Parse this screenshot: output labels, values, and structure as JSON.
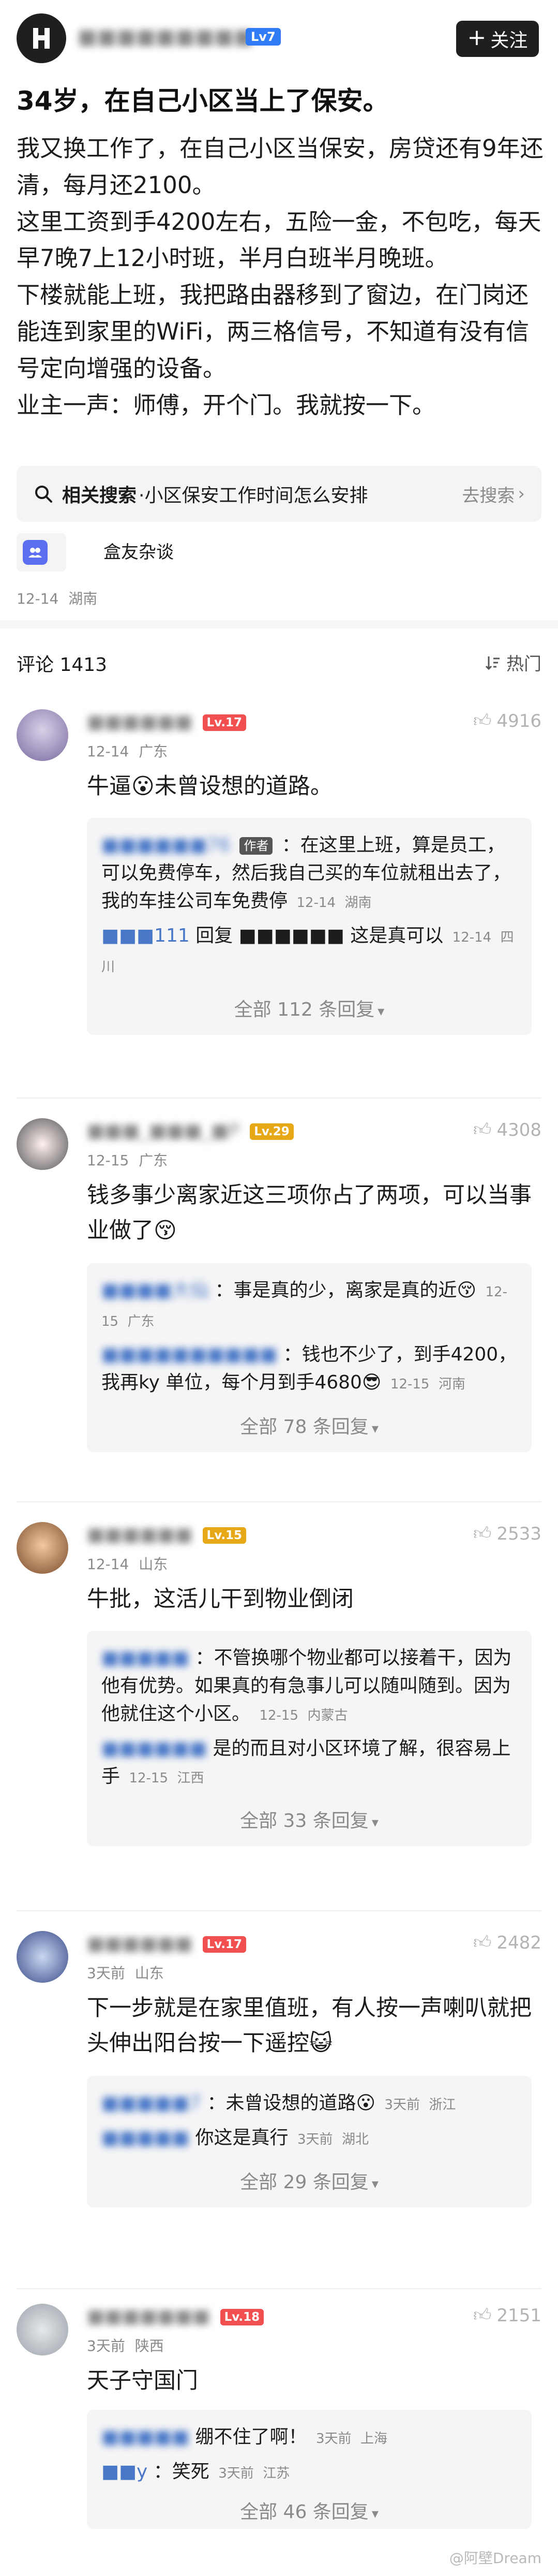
{
  "header": {
    "author_name": "■■■■■■■■■",
    "author_name_suffix": "76",
    "author_level": "Lv7",
    "follow_label": "关注"
  },
  "post": {
    "title": "34岁，在自己小区当上了保安。",
    "paragraphs": [
      "我又换工作了，在自己小区当保安，房贷还有9年还清，每月还2100。",
      "这里工资到手4200左右，五险一金，不包吃，每天早7晚7上12小时班，半月白班半月晚班。",
      "下楼就能上班，我把路由器移到了窗边，在门岗还能连到家里的WiFi，两三格信号，不知道有没有信号定向增强的设备。",
      "业主一声：师傅，开个门。我就按一下。"
    ],
    "related_search_prefix": "相关搜索",
    "related_search_text": "·小区保安工作时间怎么安排",
    "related_search_go": "去搜索",
    "circle_label": "盒友杂谈",
    "date": "12-14",
    "location": "湖南"
  },
  "comments_header": {
    "label": "评论",
    "count": "1413",
    "sort_label": "热门"
  },
  "comments": [
    {
      "name": "■■■■■■",
      "level": "Lv.17",
      "date": "12-14",
      "location": "广东",
      "likes": "4916",
      "text": "牛逼😮未曾设想的道路。",
      "replies": [
        {
          "name": "■■■■■■76",
          "tag": "作者",
          "text": "：在这里上班，算是员工，可以免费停车，然后我自己买的车位就租出去了，我的车挂公司车免费停",
          "date": "12-14",
          "location": "湖南"
        },
        {
          "name": "■■■111",
          "tag": "",
          "text": "回复 ■■■■■■ 这是真可以",
          "date": "12-14",
          "location": "四川"
        }
      ],
      "all_replies": "全部 112 条回复"
    },
    {
      "name": "■■■_■■■_■P",
      "level": "Lv.29",
      "date": "12-15",
      "location": "广东",
      "likes": "4308",
      "text": "钱多事少离家近这三项你占了两项，可以当事业做了😚",
      "replies": [
        {
          "name": "■■■■大仙",
          "tag": "",
          "text": "：事是真的少，离家是真的近😚",
          "date": "12-15",
          "location": "广东"
        },
        {
          "name": "■■■■■■■■■■",
          "tag": "",
          "text": "：钱也不少了，到手4200，我再ky 单位，每个月到手4680😎",
          "date": "12-15",
          "location": "河南"
        }
      ],
      "all_replies": "全部 78 条回复"
    },
    {
      "name": "■■■■■■",
      "level": "Lv.15",
      "date": "12-14",
      "location": "山东",
      "likes": "2533",
      "text": "牛批，这活儿干到物业倒闭",
      "replies": [
        {
          "name": "■■■■■",
          "tag": "",
          "text": "：不管换哪个物业都可以接着干，因为他有优势。如果真的有急事儿可以随叫随到。因为他就住这个小区。",
          "date": "12-15",
          "location": "内蒙古"
        },
        {
          "name": "■■■■■■",
          "tag": "",
          "text": "是的而且对小区环境了解，很容易上手",
          "date": "12-15",
          "location": "江西"
        }
      ],
      "all_replies": "全部 33 条回复"
    },
    {
      "name": "■■■■■■",
      "level": "Lv.17",
      "date": "3天前",
      "location": "山东",
      "likes": "2482",
      "text": "下一步就是在家里值班，有人按一声喇叭就把头伸出阳台按一下遥控😺",
      "replies": [
        {
          "name": "■■■■■7",
          "tag": "",
          "text": "：未曾设想的道路😮",
          "date": "3天前",
          "location": "浙江"
        },
        {
          "name": "■■■■■",
          "tag": "",
          "text": "你这是真行",
          "date": "3天前",
          "location": "湖北"
        }
      ],
      "all_replies": "全部 29 条回复"
    },
    {
      "name": "■■■■■■■",
      "level": "Lv.18",
      "date": "3天前",
      "location": "陕西",
      "likes": "2151",
      "text": "天子守国门",
      "replies": [
        {
          "name": "■■■■■",
          "tag": "",
          "text": "绷不住了啊！",
          "date": "3天前",
          "location": "上海"
        },
        {
          "name": "■■y",
          "tag": "",
          "text": "：笑死",
          "date": "3天前",
          "location": "江苏"
        }
      ],
      "all_replies": "全部 46 条回复"
    }
  ],
  "watermark": "@阿壁Dream",
  "colors": {
    "accent_blue": "#2f7cf6",
    "level_red": "#f25050",
    "level_gold": "#e6a817",
    "follow_bg": "#1f1f1f"
  }
}
